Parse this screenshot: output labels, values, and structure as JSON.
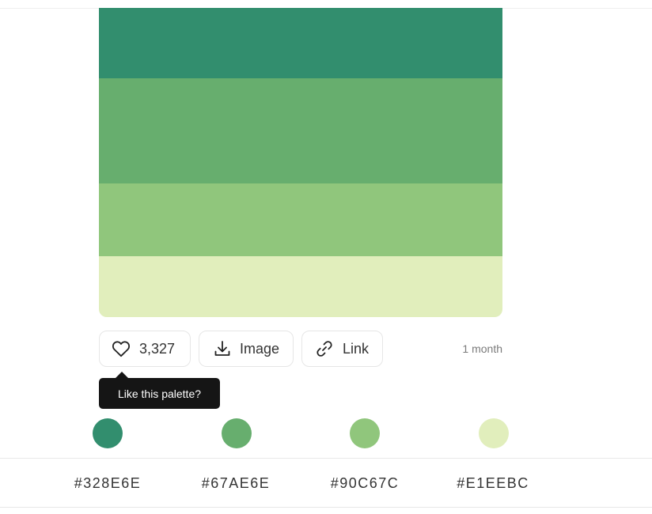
{
  "palette": {
    "colors": [
      "#328E6E",
      "#67AE6E",
      "#90C67C",
      "#E1EEBC"
    ],
    "codes": [
      "#328E6E",
      "#67AE6E",
      "#90C67C",
      "#E1EEBC"
    ]
  },
  "actions": {
    "like_count": "3,327",
    "image_label": "Image",
    "link_label": "Link",
    "age": "1 month"
  },
  "tooltip": {
    "text": "Like this palette?"
  },
  "icons": {
    "like": "heart-icon",
    "image": "download-icon",
    "link": "link-icon"
  }
}
